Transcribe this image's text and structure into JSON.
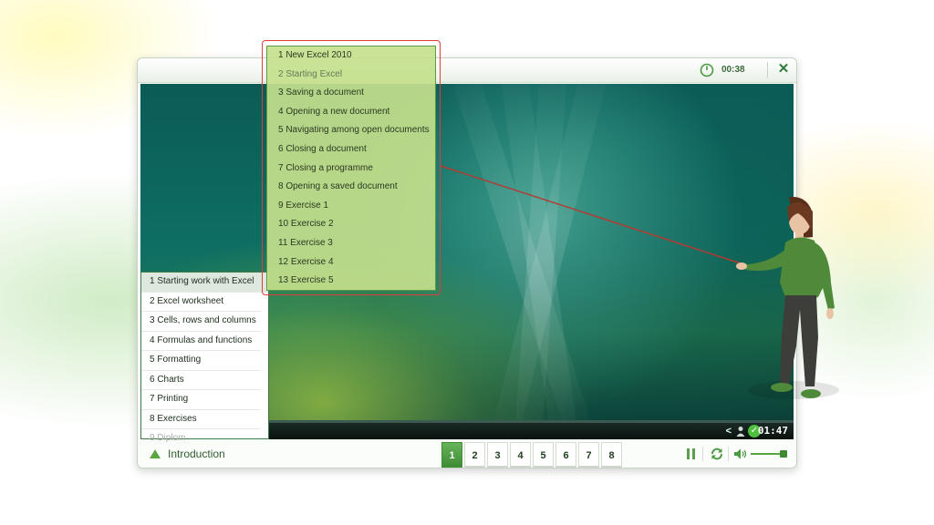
{
  "window": {
    "time_elapsed": "00:38",
    "close_icon": "close-icon",
    "clock_icon": "clock-icon"
  },
  "video": {
    "time": "01:47",
    "back_glyph": "<",
    "check_glyph": "✓"
  },
  "chapters": [
    {
      "label": "1 Starting work with Excel",
      "active": true
    },
    {
      "label": "2 Excel worksheet"
    },
    {
      "label": "3 Cells, rows and columns"
    },
    {
      "label": "4 Formulas and functions"
    },
    {
      "label": "5 Formatting"
    },
    {
      "label": "6 Charts"
    },
    {
      "label": "7 Printing"
    },
    {
      "label": "8 Exercises"
    },
    {
      "label": "9 Diplom",
      "disabled": true
    }
  ],
  "lessons": [
    {
      "label": "1 New Excel 2010"
    },
    {
      "label": "2 Starting Excel",
      "dim": true
    },
    {
      "label": "3 Saving a document"
    },
    {
      "label": "4 Opening a new document"
    },
    {
      "label": "5 Navigating among open documents"
    },
    {
      "label": "6 Closing a document"
    },
    {
      "label": "7 Closing a programme"
    },
    {
      "label": "8 Opening a saved document"
    },
    {
      "label": "9 Exercise 1"
    },
    {
      "label": "10 Exercise 2"
    },
    {
      "label": "11 Exercise 3"
    },
    {
      "label": "12 Exercise 4"
    },
    {
      "label": "13 Exercise 5"
    }
  ],
  "bottombar": {
    "intro_label": "Introduction",
    "pages": [
      "1",
      "2",
      "3",
      "4",
      "5",
      "6",
      "7",
      "8"
    ],
    "active_page": "1"
  },
  "colors": {
    "accent": "#3f8d35",
    "highlight_border": "#e33a3a",
    "submenu_bg": "#c4e08c"
  }
}
